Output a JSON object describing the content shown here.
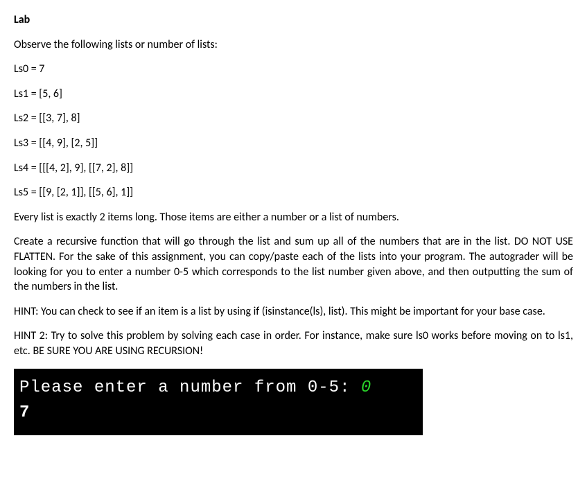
{
  "heading": "Lab",
  "intro": "Observe the following lists or number of lists:",
  "ls0": "Ls0 = 7",
  "ls1": "Ls1 = [5, 6]",
  "ls2": "Ls2 = [[3, 7], 8]",
  "ls3": "Ls3 = [[4, 9], [2, 5]]",
  "ls4": "Ls4 = [[[4, 2], 9], [[7, 2], 8]]",
  "ls5": "Ls5 = [[9, [2, 1]], [[5, 6], 1]]",
  "note": "Every list is exactly 2 items long.  Those items are either a number or a list of numbers.",
  "task": "Create a recursive function that will go through the list and sum up all of the numbers that are in the list. DO NOT USE FLATTEN.  For the sake of this assignment, you can copy/paste each of the lists into your program.  The autograder will be looking for you to enter a number 0-5 which corresponds to the list number given above, and then outputting the sum of the numbers in the list.",
  "hint1": "HINT: You can check to see if an item is a list by using if (isinstance(ls), list).  This might be important for your base case.",
  "hint2": "HINT 2: Try to solve this problem by solving each case in order.  For instance, make sure ls0 works before moving on to ls1, etc.  BE SURE YOU ARE USING RECURSION!",
  "terminal": {
    "prompt": "Please enter a number from 0-5: ",
    "input": "0",
    "output": "7"
  }
}
